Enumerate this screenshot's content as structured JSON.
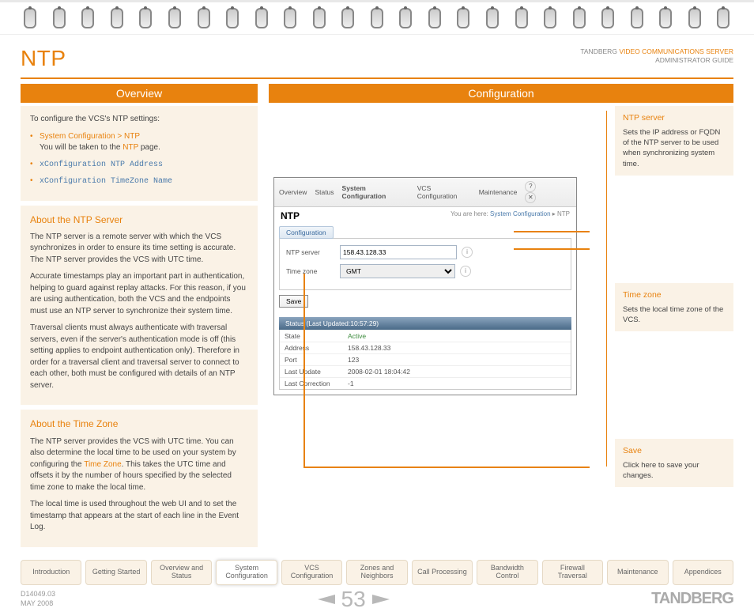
{
  "header": {
    "title": "NTP",
    "doc_title_line1": "VIDEO COMMUNICATIONS SERVER",
    "doc_title_prefix": "TANDBERG",
    "doc_title_line2": "ADMINISTRATOR GUIDE"
  },
  "left": {
    "overview": "Overview",
    "intro": {
      "lead": "To configure the VCS's NTP settings:",
      "nav_path": "System Configuration > NTP",
      "nav_sentence_1": "You will be taken to the ",
      "nav_page": "NTP",
      "nav_sentence_2": " page.",
      "xcfg1": "xConfiguration NTP Address",
      "xcfg2": "xConfiguration TimeZone Name"
    },
    "ntp": {
      "title": "About the NTP Server",
      "p1": "The NTP server is a remote server with which the VCS synchronizes in order to ensure its time setting is accurate.  The NTP server provides the VCS with UTC time.",
      "p2": "Accurate timestamps play an important part in authentication, helping to guard against replay attacks.  For this reason, if you are using authentication, both the VCS and the endpoints must use an NTP server to synchronize their system time.",
      "p3": "Traversal clients must always authenticate with traversal servers, even if the server's authentication mode is off (this setting applies to endpoint authentication only).  Therefore in order for a traversal client and traversal server to connect to each other, both must be configured with details of an NTP server."
    },
    "tz": {
      "title": "About the Time Zone",
      "p1a": "The NTP server provides the VCS with UTC time.  You can also determine the local time to be used on your system by configuring the ",
      "p1link": "Time Zone",
      "p1b": ".  This takes the UTC time and offsets it by the number of hours specified by the selected time zone to make the local time.",
      "p2": "The local time is used throughout the web UI and to set the timestamp that appears at the start of each line in the Event Log."
    }
  },
  "right": {
    "header": "Configuration",
    "ntp_server": {
      "h": "NTP server",
      "p": "Sets the IP address or FQDN of the NTP server to be used when synchronizing system time."
    },
    "tz": {
      "h": "Time zone",
      "p": "Sets the local time zone of the VCS."
    },
    "save": {
      "h": "Save",
      "p": "Click here to save your changes."
    }
  },
  "cs": {
    "tabs": {
      "overview": "Overview",
      "status": "Status",
      "syscfg": "System Configuration",
      "vcscfg": "VCS Configuration",
      "maint": "Maintenance"
    },
    "title": "NTP",
    "bc_lead": "You are here: ",
    "bc1": "System Configuration",
    "bc2": "NTP",
    "subtab": "Configuration",
    "form": {
      "ntp_label": "NTP server",
      "ntp_value": "158.43.128.33",
      "tz_label": "Time zone",
      "tz_value": "GMT"
    },
    "save": "Save",
    "status_title": "Status (Last Updated:10:57:29)",
    "rows": {
      "state_k": "State",
      "state_v": "Active",
      "addr_k": "Address",
      "addr_v": "158.43.128.33",
      "port_k": "Port",
      "port_v": "123",
      "lu_k": "Last Update",
      "lu_v": "2008-02-01 18:04:42",
      "lc_k": "Last Correction",
      "lc_v": "-1"
    }
  },
  "tabs": [
    "Introduction",
    "Getting Started",
    "Overview and Status",
    "System Configuration",
    "VCS Configuration",
    "Zones and Neighbors",
    "Call Processing",
    "Bandwidth Control",
    "Firewall Traversal",
    "Maintenance",
    "Appendices"
  ],
  "footer": {
    "doc_id": "D14049.03",
    "date": "MAY 2008",
    "page": "53",
    "brand": "TANDBERG"
  }
}
